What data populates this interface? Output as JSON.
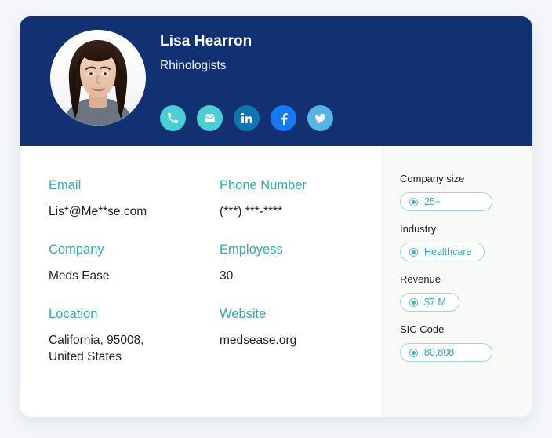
{
  "colors": {
    "page_background": "#f4f6fb",
    "card_background": "#ffffff",
    "header_navy": "#123172",
    "label_teal": "#35a8b0",
    "side_panel_background": "#f7faf7",
    "pill_border": "#9fd9d8",
    "social_teal": "#4ccfd4",
    "social_linkedin": "#1175b3",
    "social_facebook": "#1877f2",
    "social_twitter": "#57b2e8"
  },
  "header": {
    "name": "Lisa Hearron",
    "role": "Rhinologists",
    "avatar_alt": "profile-photo",
    "socials": [
      {
        "name": "phone",
        "label": "Phone"
      },
      {
        "name": "email",
        "label": "Email"
      },
      {
        "name": "linkedin",
        "label": "LinkedIn"
      },
      {
        "name": "facebook",
        "label": "Facebook"
      },
      {
        "name": "twitter",
        "label": "Twitter"
      }
    ]
  },
  "details": {
    "rows": [
      [
        {
          "label": "Email",
          "value": "Lis*@Me**se.com"
        },
        {
          "label": "Phone Number",
          "value": "(***) ***-****"
        }
      ],
      [
        {
          "label": "Company",
          "value": "Meds Ease"
        },
        {
          "label": "Employess",
          "value": "30"
        }
      ],
      [
        {
          "label": "Location",
          "value": "California, 95008, United States"
        },
        {
          "label": "Website",
          "value": "medsease.org"
        }
      ]
    ]
  },
  "side_panel": {
    "blocks": [
      {
        "label": "Company size",
        "value": "25+"
      },
      {
        "label": "Industry",
        "value": "Healthcare"
      },
      {
        "label": "Revenue",
        "value": "$7 M"
      },
      {
        "label": "SIC Code",
        "value": "80,808"
      }
    ]
  }
}
